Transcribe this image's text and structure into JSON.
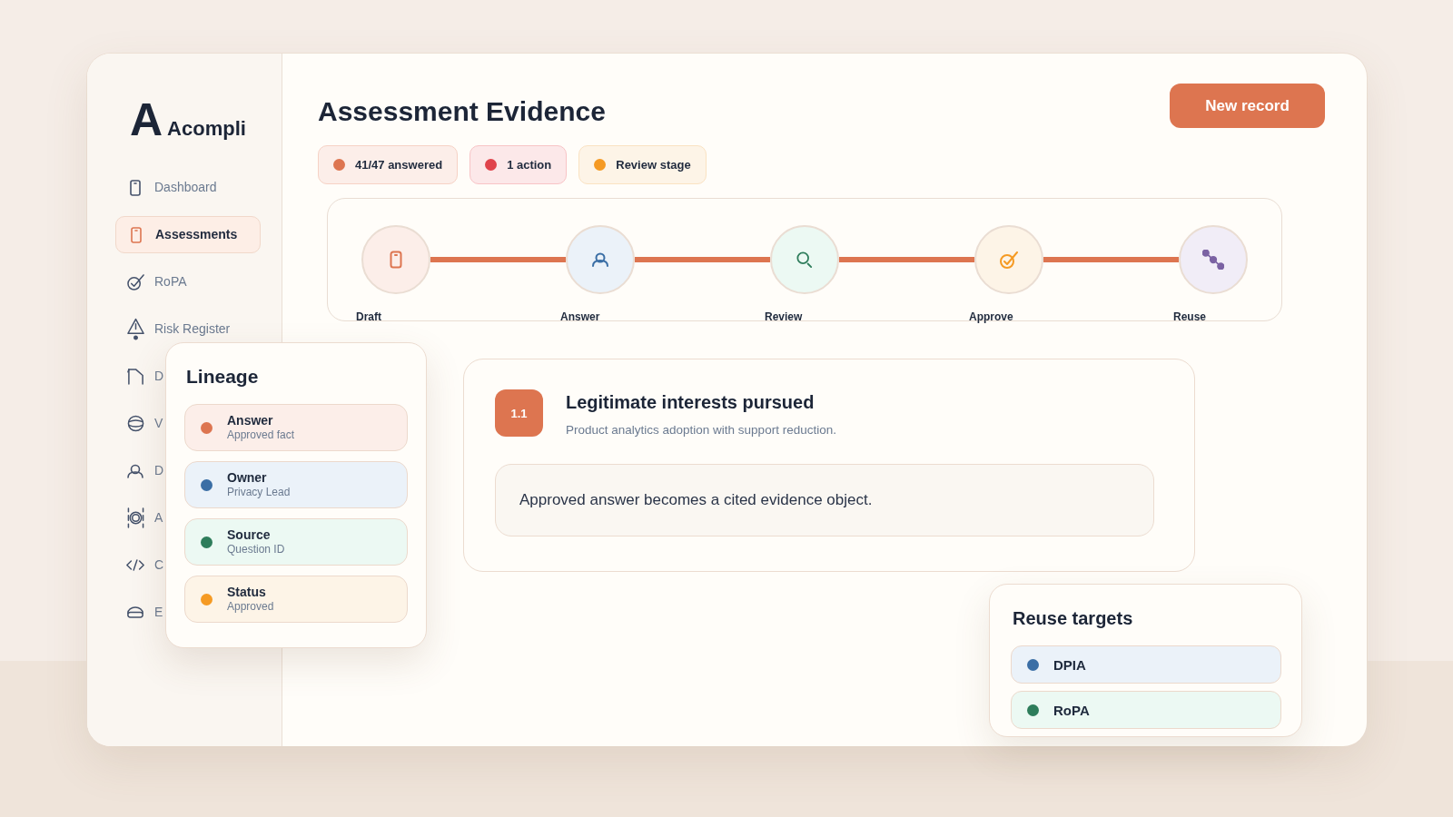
{
  "sidebar": {
    "logo": {
      "mark": "A",
      "name": "Acompli"
    },
    "items": [
      {
        "label": "Dashboard",
        "selected": false
      },
      {
        "label": "Assessments",
        "selected": true
      },
      {
        "label": "RoPA",
        "selected": false
      },
      {
        "label": "Risk Register",
        "selected": false
      },
      {
        "label": "D",
        "selected": false
      },
      {
        "label": "V",
        "selected": false
      },
      {
        "label": "D",
        "selected": false
      },
      {
        "label": "A",
        "selected": false
      },
      {
        "label": "C",
        "selected": false
      },
      {
        "label": "E",
        "selected": false
      }
    ]
  },
  "header": {
    "title": "Assessment Evidence",
    "primary_button": "New record",
    "chips": [
      {
        "label": "41/47 answered",
        "color": "#dd7550"
      },
      {
        "label": "1 action",
        "color": "#e0434b"
      },
      {
        "label": "Review stage",
        "color": "#f59a23"
      }
    ]
  },
  "stepper": {
    "steps": [
      {
        "label": "Draft",
        "color": "#dd7550"
      },
      {
        "label": "Answer",
        "color": "#3a6ea5"
      },
      {
        "label": "Review",
        "color": "#2e7d5b"
      },
      {
        "label": "Approve",
        "color": "#f59a23"
      },
      {
        "label": "Reuse",
        "color": "#7b62a3"
      }
    ]
  },
  "question_card": {
    "number": "1.1",
    "title": "Legitimate interests pursued",
    "description": "Product analytics adoption with support reduction.",
    "evidence": "Approved answer becomes a cited evidence object."
  },
  "lineage_panel": {
    "title": "Lineage",
    "rows": [
      {
        "label": "Answer",
        "value": "Approved fact",
        "color": "#dd7550"
      },
      {
        "label": "Owner",
        "value": "Privacy Lead",
        "color": "#3a6ea5"
      },
      {
        "label": "Source",
        "value": "Question ID",
        "color": "#2e7d5b"
      },
      {
        "label": "Status",
        "value": "Approved",
        "color": "#f59a23"
      }
    ]
  },
  "reuse_panel": {
    "title": "Reuse targets",
    "targets": [
      {
        "label": "DPIA",
        "color": "#3a6ea5"
      },
      {
        "label": "RoPA",
        "color": "#2e7d5b"
      }
    ]
  }
}
